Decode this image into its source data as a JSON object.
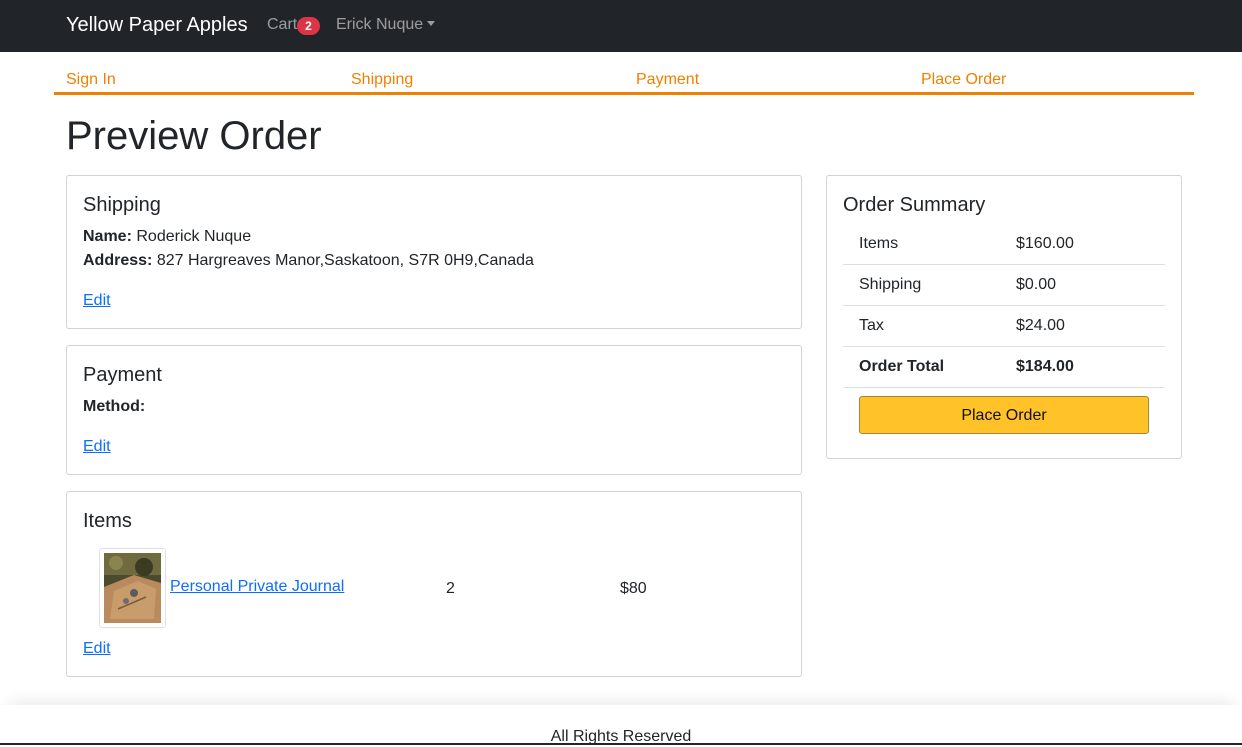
{
  "colors": {
    "navbar_bg": "#212529",
    "accent_orange": "#f08000",
    "badge_red": "#dc3545",
    "button_yellow": "#ffc229",
    "link_blue": "#0d6efd"
  },
  "navbar": {
    "brand": "Yellow Paper Apples",
    "cart_label": "Cart",
    "cart_count": "2",
    "user_name": "Erick Nuque",
    "user_menu_icon": "caret-down-icon"
  },
  "checkout_steps": [
    "Sign In",
    "Shipping",
    "Payment",
    "Place Order"
  ],
  "page_title": "Preview Order",
  "shipping": {
    "title": "Shipping",
    "name_label": "Name:",
    "name": "Roderick Nuque",
    "address_label": "Address:",
    "address": "827 Hargreaves Manor,Saskatoon, S7R 0H9,Canada",
    "edit_label": "Edit"
  },
  "payment": {
    "title": "Payment",
    "method_label": "Method:",
    "method": "",
    "edit_label": "Edit"
  },
  "items": {
    "title": "Items",
    "list": [
      {
        "name": "Personal Private Journal",
        "quantity": "2",
        "price": "$80",
        "image_icon": "journal-product-image"
      }
    ],
    "edit_label": "Edit"
  },
  "order_summary": {
    "title": "Order Summary",
    "rows": [
      {
        "label": "Items",
        "value": "$160.00"
      },
      {
        "label": "Shipping",
        "value": "$0.00"
      },
      {
        "label": "Tax",
        "value": "$24.00"
      },
      {
        "label": "Order Total",
        "value": "$184.00"
      }
    ],
    "place_order_label": "Place Order"
  },
  "footer": {
    "text": "All Rights Reserved"
  }
}
